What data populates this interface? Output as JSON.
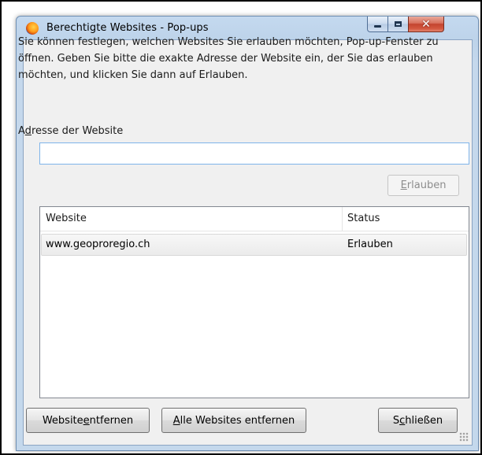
{
  "window": {
    "title": "Berechtigte Websites - Pop-ups",
    "icon": "firefox-icon"
  },
  "intro_text": "Sie können festlegen, welchen Websites Sie erlauben möchten, Pop-up-Fenster zu öffnen. Geben Sie bitte die exakte Adresse der Website ein, der Sie das erlauben möchten, und klicken Sie dann auf Erlauben.",
  "address": {
    "label_pre": "A",
    "label_accel": "d",
    "label_post": "resse der Website",
    "value": ""
  },
  "allow_button": {
    "accel": "E",
    "rest": "rlauben",
    "enabled": false
  },
  "list": {
    "columns": [
      "Website",
      "Status"
    ],
    "rows": [
      {
        "site": "www.geoproregio.ch",
        "status": "Erlauben"
      }
    ]
  },
  "footer": {
    "remove": {
      "pre": "Website ",
      "accel": "e",
      "post": "ntfernen"
    },
    "remove_all": {
      "pre": "",
      "accel": "A",
      "post": "lle Websites entfernen"
    },
    "close": {
      "pre": "S",
      "accel": "c",
      "post": "hließen"
    }
  },
  "colors": {
    "title_bar": "#c4d9ef",
    "close_button": "#c44530",
    "input_border": "#7eb4ea",
    "dialog_bg": "#f0f0f0"
  }
}
